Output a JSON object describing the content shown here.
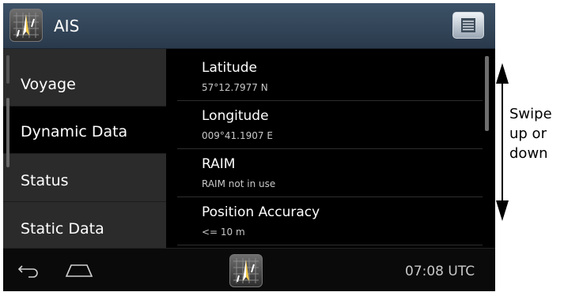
{
  "header": {
    "title": "AIS",
    "app_icon": "radar-compass-icon",
    "menu_icon": "menu-list-icon"
  },
  "sidebar": {
    "items": [
      {
        "label": "Voyage",
        "active": false
      },
      {
        "label": "Dynamic Data",
        "active": true
      },
      {
        "label": "Status",
        "active": false
      },
      {
        "label": "Static Data",
        "active": false
      }
    ]
  },
  "content": {
    "rows": [
      {
        "label": "Latitude",
        "value": "57°12.7977 N"
      },
      {
        "label": "Longitude",
        "value": "009°41.1907 E"
      },
      {
        "label": "RAIM",
        "value": "RAIM not in use"
      },
      {
        "label": "Position Accuracy",
        "value": "<= 10 m"
      }
    ]
  },
  "navbar": {
    "back_icon": "back-icon",
    "home_icon": "home-icon",
    "app_icon": "radar-compass-icon",
    "clock": "07:08 UTC"
  },
  "annotation": {
    "text": "Swipe\nup or\ndown",
    "icon": "double-arrow-vertical-icon"
  },
  "colors": {
    "title_bar": "#34485c",
    "sidebar": "#2b2b2b",
    "active_item": "#000000"
  }
}
